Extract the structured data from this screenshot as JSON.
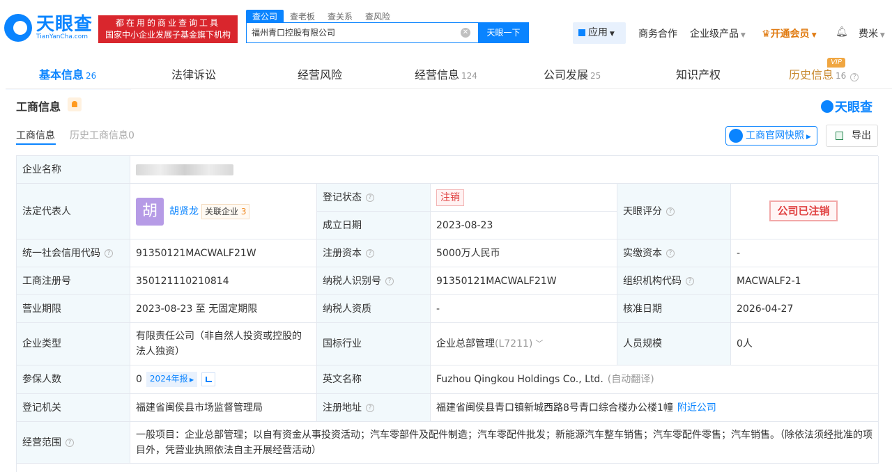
{
  "header": {
    "logo_cn": "天眼查",
    "logo_en": "TianYanCha.com",
    "slogan_line1": "都在用的商业查询工具",
    "slogan_line2": "国家中小企业发展子基金旗下机构",
    "search_tabs": [
      "查公司",
      "查老板",
      "查关系",
      "查风险"
    ],
    "search_value": "福州青口控股有限公司",
    "search_button": "天眼一下",
    "nav": {
      "app": "应用",
      "business": "商务合作",
      "enterprise": "企业级产品",
      "vip": "开通会员",
      "user": "费米"
    }
  },
  "tabs": [
    {
      "label": "基本信息",
      "count": "26"
    },
    {
      "label": "法律诉讼",
      "count": ""
    },
    {
      "label": "经营风险",
      "count": ""
    },
    {
      "label": "经营信息",
      "count": "124"
    },
    {
      "label": "公司发展",
      "count": "25"
    },
    {
      "label": "知识产权",
      "count": ""
    },
    {
      "label": "历史信息",
      "count": "16"
    }
  ],
  "vip_badge": "VIP",
  "section": {
    "title": "工商信息",
    "brand": "天眼查",
    "subtab_active": "工商信息",
    "subtab_history": "历史工商信息0",
    "snapshot_button": "工商官网快照",
    "export_button": "导出"
  },
  "info": {
    "company_name_label": "企业名称",
    "legal_rep_label": "法定代表人",
    "legal_rep_avatar": "胡",
    "legal_rep_name": "胡贤龙",
    "related_label": "关联企业",
    "related_count": "3",
    "reg_status_label": "登记状态",
    "reg_status_value": "注销",
    "found_date_label": "成立日期",
    "found_date_value": "2023-08-23",
    "score_label": "天眼评分",
    "score_stamp": "公司已注销",
    "credit_code_label": "统一社会信用代码",
    "credit_code_value": "91350121MACWALF21W",
    "reg_capital_label": "注册资本",
    "reg_capital_value": "5000万人民币",
    "paid_capital_label": "实缴资本",
    "paid_capital_value": "-",
    "reg_no_label": "工商注册号",
    "reg_no_value": "350121110210814",
    "tax_id_label": "纳税人识别号",
    "tax_id_value": "91350121MACWALF21W",
    "org_code_label": "组织机构代码",
    "org_code_value": "MACWALF2-1",
    "term_label": "营业期限",
    "term_value": "2023-08-23 至 无固定期限",
    "tax_qual_label": "纳税人资质",
    "tax_qual_value": "-",
    "approve_label": "核准日期",
    "approve_value": "2026-04-27",
    "type_label": "企业类型",
    "type_value": "有限责任公司（非自然人投资或控股的法人独资）",
    "industry_label": "国标行业",
    "industry_value": "企业总部管理",
    "industry_code": "(L7211)",
    "staff_label": "人员规模",
    "staff_value": "0人",
    "insured_label": "参保人数",
    "insured_value": "0",
    "report_tag": "2024年报",
    "en_name_label": "英文名称",
    "en_name_value": "Fuzhou Qingkou Holdings Co., Ltd.",
    "en_name_note": "(自动翻译)",
    "authority_label": "登记机关",
    "authority_value": "福建省闽侯县市场监督管理局",
    "address_label": "注册地址",
    "address_value": "福建省闽侯县青口镇新城西路8号青口综合楼办公楼1幢",
    "nearby_link": "附近公司",
    "scope_label": "经营范围",
    "scope_value": "一般项目：企业总部管理；以自有资金从事投资活动；汽车零部件及配件制造；汽车零配件批发；新能源汽车整车销售；汽车零配件零售；汽车销售。（除依法须经批准的项目外，凭营业执照依法自主开展经营活动）"
  }
}
